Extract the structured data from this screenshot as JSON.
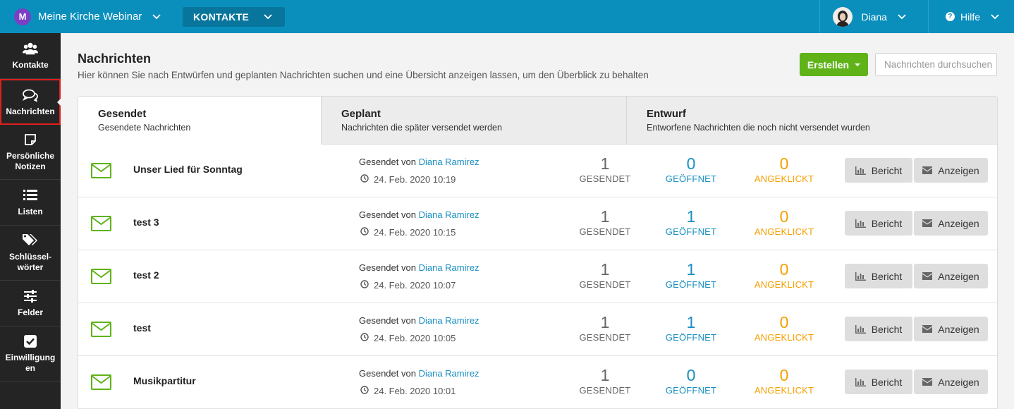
{
  "topbar": {
    "org_initial": "M",
    "org_name": "Meine Kirche Webinar",
    "module": "KONTAKTE",
    "user_name": "Diana",
    "help": "Hilfe"
  },
  "sidebar": {
    "items": [
      {
        "label": "Kontakte",
        "icon": "users-icon"
      },
      {
        "label": "Nachrichten",
        "icon": "chat-bubbles-icon"
      },
      {
        "label": "Persönliche Notizen",
        "icon": "note-icon"
      },
      {
        "label": "Listen",
        "icon": "list-icon"
      },
      {
        "label": "Schlüssel-wörter",
        "icon": "tag-icon"
      },
      {
        "label": "Felder",
        "icon": "sliders-icon"
      },
      {
        "label": "Einwilligungen",
        "icon": "checkbox-icon"
      }
    ]
  },
  "page": {
    "title": "Nachrichten",
    "description": "Hier können Sie nach Entwürfen und geplanten Nachrichten suchen und eine Übersicht anzeigen lassen, um den Überblick zu behalten",
    "create_label": "Erstellen",
    "search_placeholder": "Nachrichten durchsuchen"
  },
  "tabs": [
    {
      "title": "Gesendet",
      "subtitle": "Gesendete Nachrichten"
    },
    {
      "title": "Geplant",
      "subtitle": "Nachrichten die später versendet werden"
    },
    {
      "title": "Entwurf",
      "subtitle": "Entworfene Nachrichten die noch nicht versendet wurden"
    }
  ],
  "labels": {
    "sent_by": "Gesendet von",
    "sent": "GESENDET",
    "opened": "GEÖFFNET",
    "clicked": "ANGEKLICKT",
    "report": "Bericht",
    "view": "Anzeigen"
  },
  "colors": {
    "topbar": "#0a8fbd",
    "accent_green": "#5fb319",
    "opened": "#1a8fc2",
    "clicked": "#f5a000"
  },
  "messages": [
    {
      "name": "Unser Lied für Sonntag",
      "sender": "Diana Ramirez",
      "date": "24. Feb. 2020 10:19",
      "sent": "1",
      "opened": "0",
      "clicked": "0"
    },
    {
      "name": "test 3",
      "sender": "Diana Ramirez",
      "date": "24. Feb. 2020 10:15",
      "sent": "1",
      "opened": "1",
      "clicked": "0"
    },
    {
      "name": "test 2",
      "sender": "Diana Ramirez",
      "date": "24. Feb. 2020 10:07",
      "sent": "1",
      "opened": "1",
      "clicked": "0"
    },
    {
      "name": "test",
      "sender": "Diana Ramirez",
      "date": "24. Feb. 2020 10:05",
      "sent": "1",
      "opened": "1",
      "clicked": "0"
    },
    {
      "name": "Musikpartitur",
      "sender": "Diana Ramirez",
      "date": "24. Feb. 2020 10:01",
      "sent": "1",
      "opened": "0",
      "clicked": "0"
    }
  ]
}
